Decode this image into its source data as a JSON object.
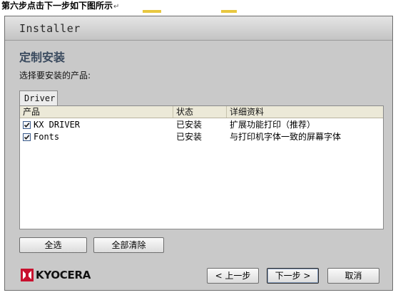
{
  "caption": {
    "text": "第六步点击下一步如下图所示",
    "return_mark": "↵"
  },
  "window": {
    "title": "Installer",
    "heading": "定制安装",
    "subtitle": "选择要安装的产品:",
    "tab_label": "Driver",
    "table": {
      "columns": [
        "产品",
        "状态",
        "详细资料"
      ],
      "rows": [
        {
          "checked": true,
          "product": "KX DRIVER",
          "status": "已安装",
          "details": "扩展功能打印（推荐）"
        },
        {
          "checked": true,
          "product": "Fonts",
          "status": "已安装",
          "details": "与打印机字体一致的屏幕字体"
        }
      ]
    },
    "buttons": {
      "select_all": "全选",
      "clear_all": "全部清除",
      "back": "< 上一步",
      "next": "下一步 >",
      "cancel": "取消"
    },
    "brand": {
      "name": "KYOCERA",
      "color": "#c8102e"
    }
  }
}
